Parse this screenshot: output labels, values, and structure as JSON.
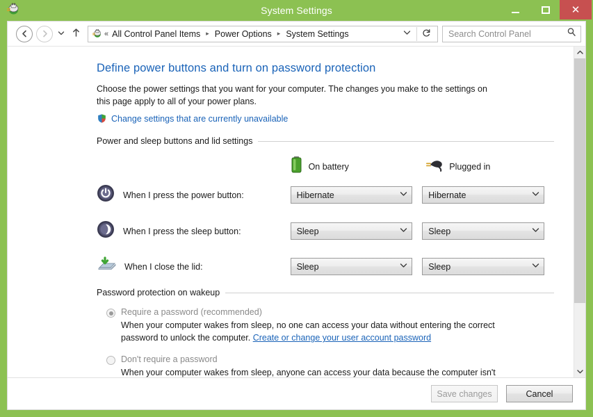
{
  "window": {
    "title": "System Settings",
    "app_icon": "power-plug-icon",
    "minimize_label": "Minimize",
    "maximize_label": "Maximize",
    "close_label": "Close",
    "colors": {
      "frame": "#8cc152",
      "close_button": "#c75050",
      "link": "#1a63b8",
      "heading": "#1a63b8"
    }
  },
  "addressbar": {
    "back_label": "Back",
    "forward_label": "Forward",
    "recent_label": "Recent locations",
    "up_label": "Up one level",
    "chevrons": "«",
    "breadcrumb": [
      {
        "label": "All Control Panel Items"
      },
      {
        "label": "Power Options"
      },
      {
        "label": "System Settings"
      }
    ],
    "separator": "▸",
    "caret": "⌄",
    "refresh": "↻",
    "search": {
      "placeholder": "Search Control Panel",
      "value": "",
      "icon": "search-icon"
    }
  },
  "main": {
    "title": "Define power buttons and turn on password protection",
    "description": "Choose the power settings that you want for your computer. The changes you make to the settings on this page apply to all of your power plans.",
    "uac_link": "Change settings that are currently unavailable",
    "power_section": {
      "group_label": "Power and sleep buttons and lid settings",
      "columns": [
        {
          "label": "On battery",
          "icon": "battery-icon"
        },
        {
          "label": "Plugged in",
          "icon": "power-plug-icon"
        }
      ],
      "rows": [
        {
          "icon": "power-button-icon",
          "label": "When I press the power button:",
          "on_battery": "Hibernate",
          "plugged_in": "Hibernate"
        },
        {
          "icon": "sleep-button-icon",
          "label": "When I press the sleep button:",
          "on_battery": "Sleep",
          "plugged_in": "Sleep"
        },
        {
          "icon": "laptop-lid-icon",
          "label": "When I close the lid:",
          "on_battery": "Sleep",
          "plugged_in": "Sleep"
        }
      ]
    },
    "password_section": {
      "group_label": "Password protection on wakeup",
      "options": [
        {
          "label": "Require a password (recommended)",
          "selected": true,
          "description_before": "When your computer wakes from sleep, no one can access your data without entering the correct password to unlock the computer. ",
          "description_link": "Create or change your user account password"
        },
        {
          "label": "Don't require a password",
          "selected": false,
          "description_before": "When your computer wakes from sleep, anyone can access your data because the computer isn't locked.",
          "description_link": ""
        }
      ]
    }
  },
  "scrollbar": {
    "up_arrow": "⌃",
    "down_arrow": "⌄"
  },
  "footer": {
    "save_label": "Save changes",
    "cancel_label": "Cancel"
  }
}
